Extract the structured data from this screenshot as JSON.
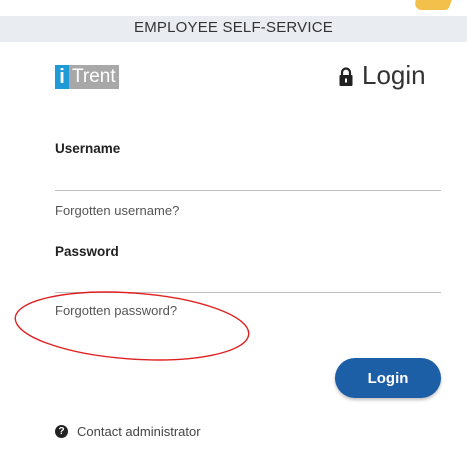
{
  "banner": {
    "title": "EMPLOYEE SELF-SERVICE"
  },
  "logo": {
    "mark": "i",
    "name": "Trent"
  },
  "header": {
    "icon": "lock-icon",
    "title": "Login"
  },
  "form": {
    "username_label": "Username",
    "username_value": "",
    "forgot_username": "Forgotten username?",
    "password_label": "Password",
    "password_value": "",
    "forgot_password": "Forgotten password?",
    "submit_label": "Login"
  },
  "footer": {
    "icon": "question-circle-icon",
    "contact_label": "Contact administrator"
  },
  "colors": {
    "banner_bg": "#e9edf1",
    "button_bg": "#1d5fa6",
    "logo_blue": "#1e9bd7",
    "annotation_red": "#e02020"
  }
}
